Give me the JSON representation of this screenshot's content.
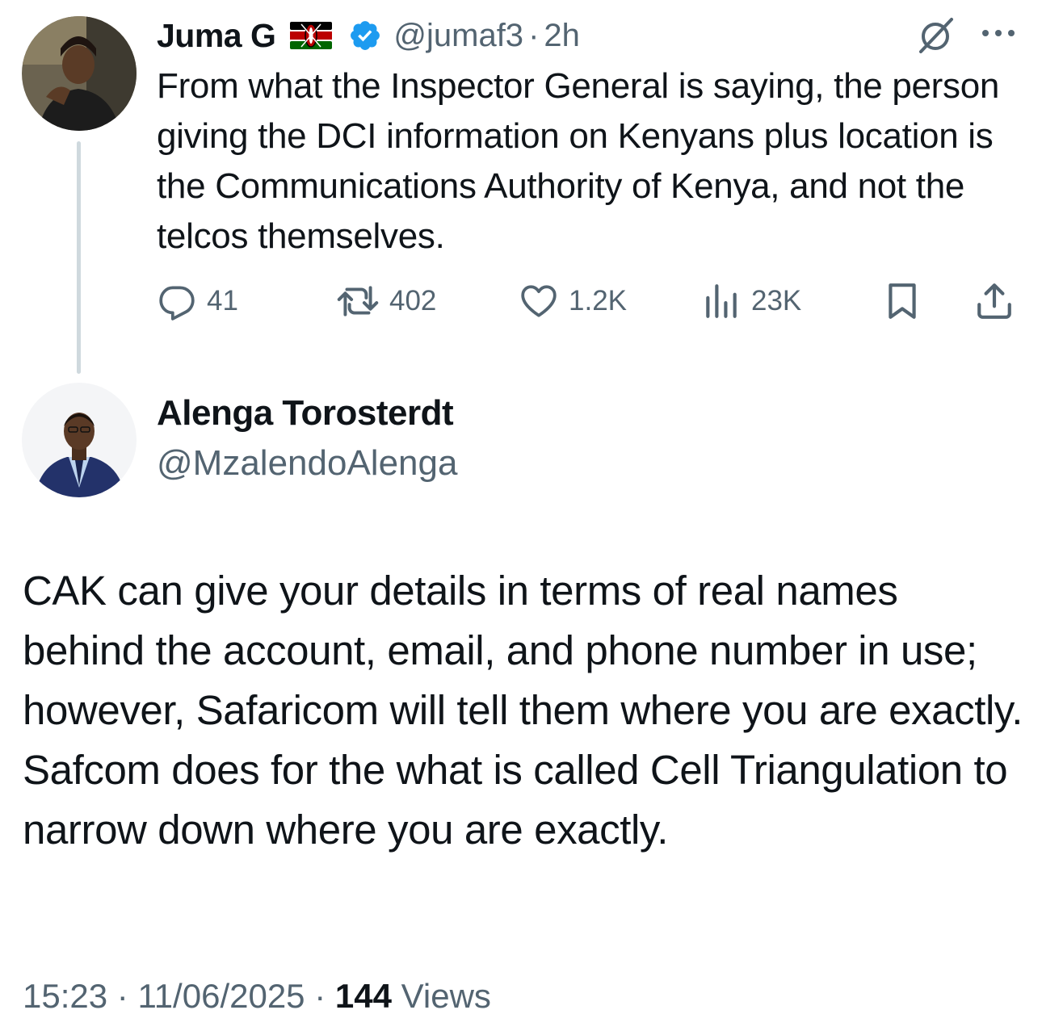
{
  "parent_tweet": {
    "display_name": "Juma G",
    "handle": "@jumaf3",
    "separator": "·",
    "time": "2h",
    "text": "From what the Inspector General is saying, the person giving the DCI information on Kenyans plus location is the Communications Authority of Kenya, and not the telcos themselves.",
    "icons": {
      "flag": "kenya-flag-emoji",
      "verified": "verified-badge-icon",
      "grok": "grok-icon",
      "more": "more-icon"
    },
    "actions": {
      "replies": "41",
      "retweets": "402",
      "likes": "1.2K",
      "views": "23K"
    },
    "colors": {
      "verified": "#1d9bf0",
      "secondary_text": "#536471",
      "thread_line": "#cfd9de"
    }
  },
  "main_tweet": {
    "display_name": "Alenga Torosterdt",
    "handle": "@MzalendoAlenga",
    "text": "CAK can give your details in terms of real names behind the account, email, and phone number in use; however, Safaricom will tell them where you are exactly. Safcom does for the what is called Cell Triangulation to narrow down where you are exactly.",
    "timestamp": "15:23",
    "date": "11/06/2025",
    "separator": "·",
    "view_count": "144",
    "views_label": "Views"
  }
}
